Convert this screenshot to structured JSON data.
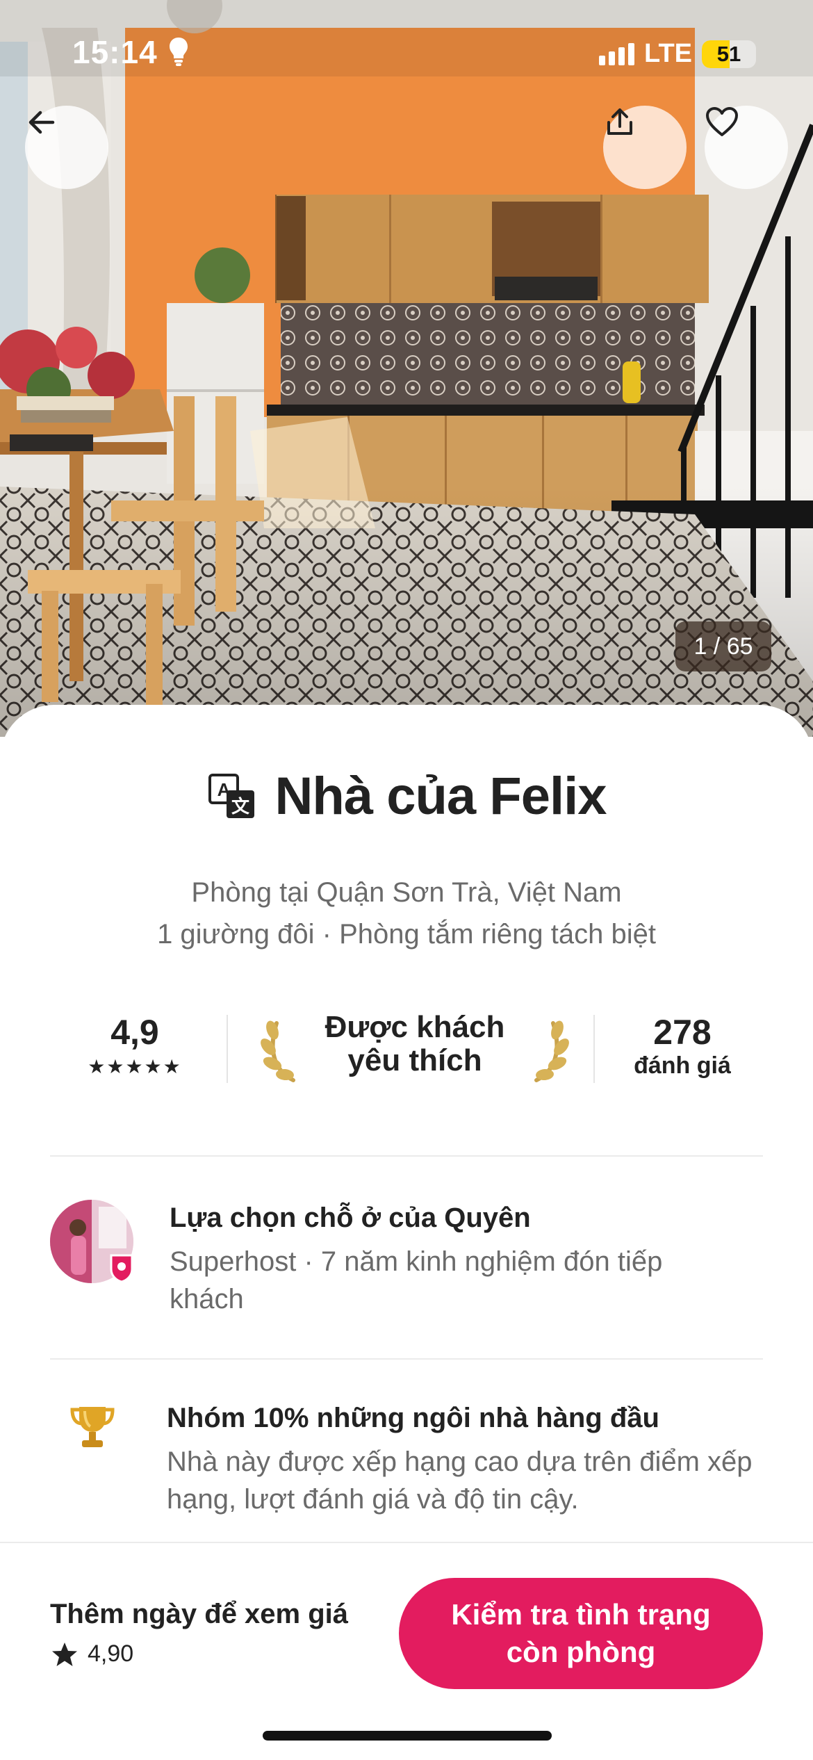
{
  "status_bar": {
    "time": "15:14",
    "network": "LTE",
    "battery_percent": "51",
    "battery_level": 0.51,
    "battery_color": "#ffd60a"
  },
  "hero": {
    "back_icon": "arrow-left-icon",
    "share_icon": "share-icon",
    "favorite_icon": "heart-outline-icon",
    "photo_counter": "1 / 65"
  },
  "listing": {
    "translate_icon": "translate-icon",
    "title": "Nhà của Felix",
    "location": "Phòng tại Quận Sơn Trà, Việt Nam",
    "details": "1 giường đôi · Phòng tắm riêng tách biệt"
  },
  "stats": {
    "rating": "4,9",
    "stars": "★★★★★",
    "guest_favorite_line1": "Được khách",
    "guest_favorite_line2": "yêu thích",
    "reviews_count": "278",
    "reviews_label": "đánh giá"
  },
  "host": {
    "title": "Lựa chọn chỗ ở của Quyên",
    "subtitle": "Superhost · 7 năm kinh nghiệm đón tiếp khách"
  },
  "highlight": {
    "icon": "trophy-icon",
    "title": "Nhóm 10% những ngôi nhà hàng đầu",
    "description": "Nhà này được xếp hạng cao dựa trên điểm xếp hạng, lượt đánh giá và độ tin cậy."
  },
  "footer": {
    "price_label": "Thêm ngày để xem giá",
    "rating": "4,90",
    "button_line1": "Kiểm tra tình trạng",
    "button_line2": "còn phòng",
    "accent_color": "#e31c5f"
  }
}
